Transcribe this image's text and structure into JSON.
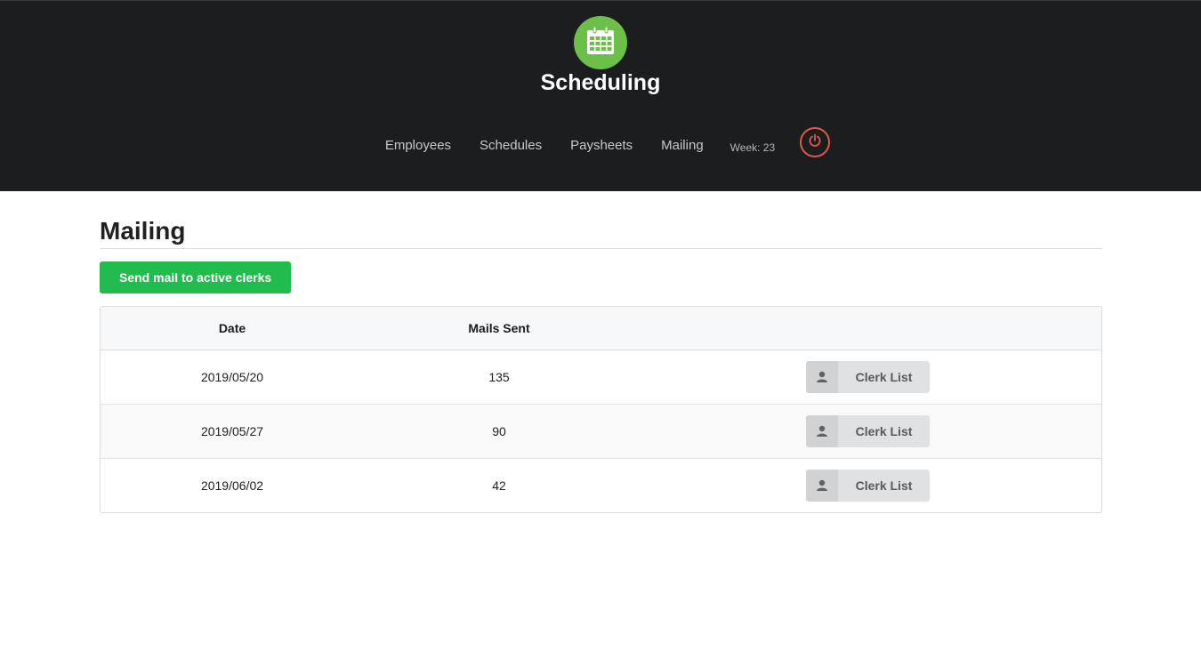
{
  "header": {
    "app_title": "Scheduling",
    "logo_icon": "calendar-icon",
    "logo_color": "#6cc04a",
    "nav": [
      {
        "label": "Employees"
      },
      {
        "label": "Schedules"
      },
      {
        "label": "Paysheets"
      },
      {
        "label": "Mailing"
      }
    ],
    "week_label": "Week: 23",
    "power_icon": "power-icon",
    "power_color": "#e2584a"
  },
  "main": {
    "title": "Mailing",
    "send_button_label": "Send mail to active clerks",
    "send_button_color": "#22bb4d",
    "table": {
      "columns": [
        "Date",
        "Mails Sent",
        ""
      ],
      "rows": [
        {
          "date": "2019/05/20",
          "mails_sent": "135",
          "action_label": "Clerk List"
        },
        {
          "date": "2019/05/27",
          "mails_sent": "90",
          "action_label": "Clerk List"
        },
        {
          "date": "2019/06/02",
          "mails_sent": "42",
          "action_label": "Clerk List"
        }
      ],
      "action_icon": "user-icon"
    }
  }
}
